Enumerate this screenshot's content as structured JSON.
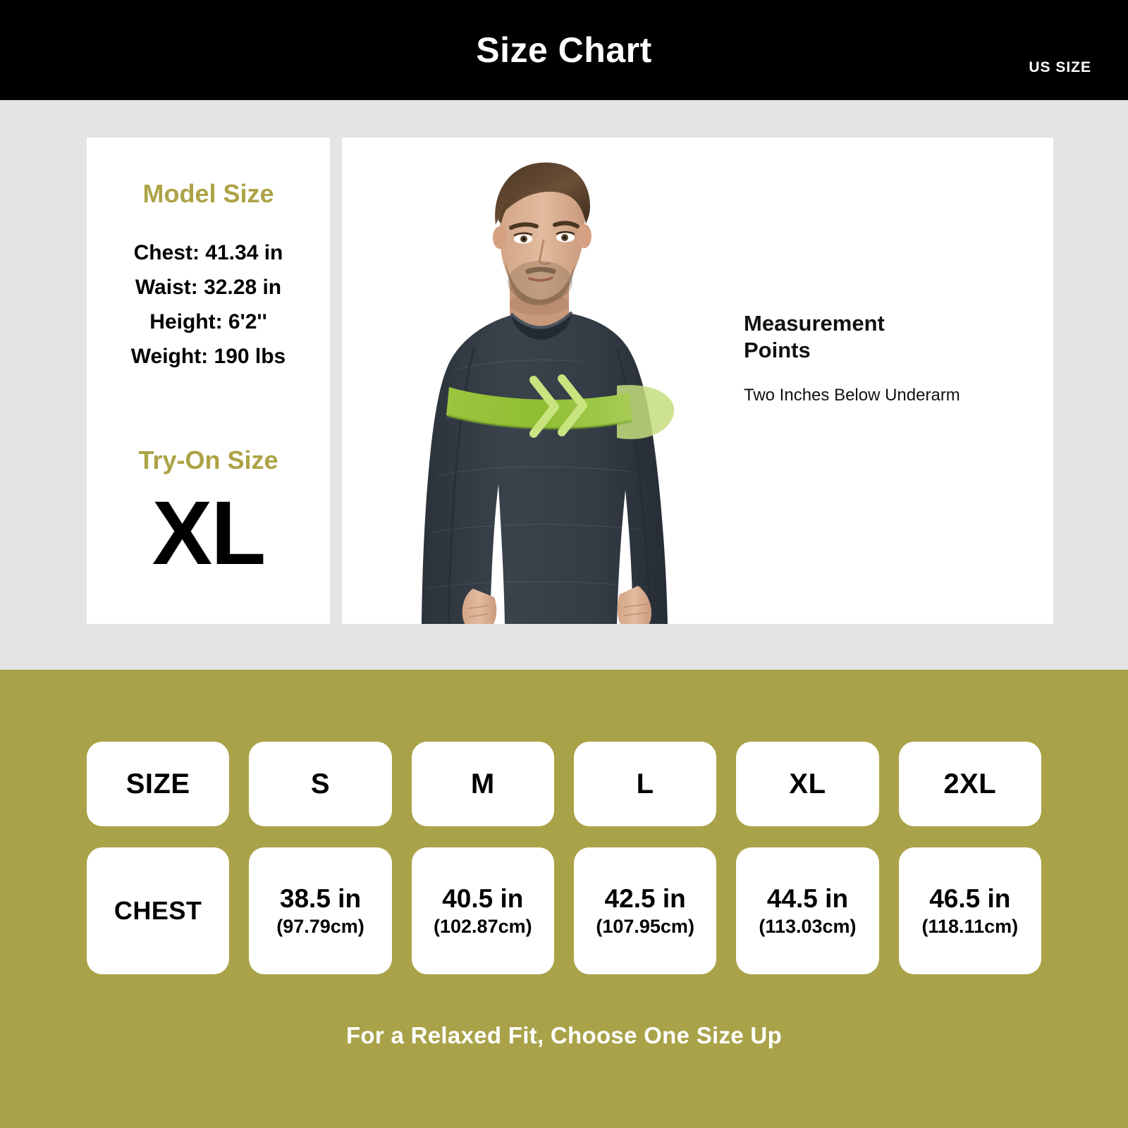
{
  "header": {
    "title": "Size Chart",
    "unit_label": "US SIZE"
  },
  "model_panel": {
    "title": "Model Size",
    "specs": {
      "chest": "Chest: 41.34 in",
      "waist": "Waist: 32.28 in",
      "height": "Height: 6'2''",
      "weight": "Weight: 190 lbs"
    },
    "tryon_title": "Try-On Size",
    "tryon_size": "XL"
  },
  "photo_panel": {
    "measurement_title_line1": "Measurement",
    "measurement_title_line2": "Points",
    "measurement_subtitle": "Two Inches Below Underarm",
    "band_icon": "double-chevron-right-icon",
    "model_alt": "male-model-wearing-charcoal-long-sleeve-thermal-shirt"
  },
  "table": {
    "row_headers": [
      "SIZE",
      "CHEST"
    ],
    "sizes": [
      "S",
      "M",
      "L",
      "XL",
      "2XL"
    ],
    "chest_in": [
      "38.5 in",
      "40.5 in",
      "42.5 in",
      "44.5 in",
      "46.5 in"
    ],
    "chest_cm": [
      "(97.79cm)",
      "(102.87cm)",
      "(107.95cm)",
      "(113.03cm)",
      "(118.11cm)"
    ]
  },
  "footnote": "For a Relaxed Fit, Choose One Size Up",
  "colors": {
    "header_bg": "#000000",
    "page_bg": "#e4e4e4",
    "olive": "#a9a249",
    "gold_text": "#ada346",
    "band_green": "#8fbe3a",
    "shirt": "#343b44",
    "white": "#ffffff"
  },
  "chart_data": {
    "type": "table",
    "title": "Size Chart",
    "categories": [
      "S",
      "M",
      "L",
      "XL",
      "2XL"
    ],
    "series": [
      {
        "name": "Chest (in)",
        "values": [
          38.5,
          40.5,
          42.5,
          44.5,
          46.5
        ]
      },
      {
        "name": "Chest (cm)",
        "values": [
          97.79,
          102.87,
          107.95,
          113.03,
          118.11
        ]
      }
    ],
    "xlabel": "SIZE",
    "ylabel": "CHEST",
    "annotations": [
      "US SIZE",
      "Two Inches Below Underarm",
      "For a Relaxed Fit, Choose One Size Up"
    ]
  }
}
